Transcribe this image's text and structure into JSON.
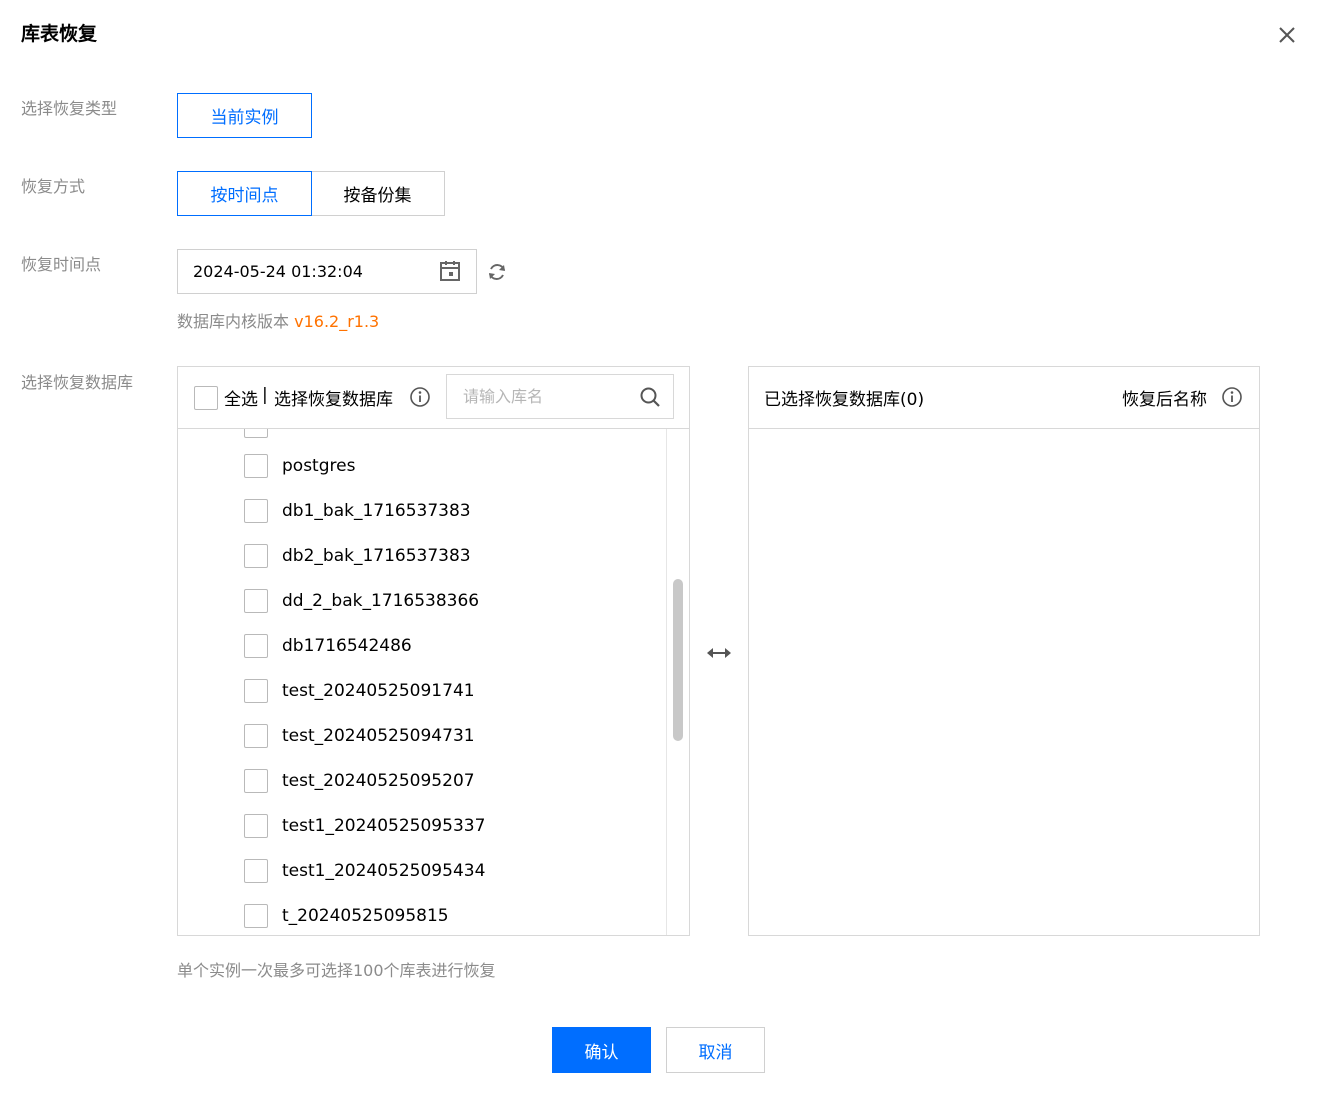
{
  "dialog": {
    "title": "库表恢复"
  },
  "restore_type": {
    "label": "选择恢复类型",
    "option": "当前实例"
  },
  "restore_method": {
    "label": "恢复方式",
    "options": [
      "按时间点",
      "按备份集"
    ],
    "selected": "按时间点"
  },
  "restore_time": {
    "label": "恢复时间点",
    "value": "2024-05-24 01:32:04",
    "version_prefix": "数据库内核版本",
    "version_value": "v16.2_r1.3"
  },
  "database_select": {
    "label": "选择恢复数据库",
    "select_all": "全选",
    "separator": "|",
    "header_title": "选择恢复数据库",
    "search_placeholder": "请输入库名",
    "items": [
      "postgres",
      "db1_bak_1716537383",
      "db2_bak_1716537383",
      "dd_2_bak_1716538366",
      "db1716542486",
      "test_20240525091741",
      "test_20240525094731",
      "test_20240525095207",
      "test1_20240525095337",
      "test1_20240525095434",
      "t_20240525095815"
    ],
    "selected_title": "已选择恢复数据库(0)",
    "rename_title": "恢复后名称",
    "hint": "单个实例一次最多可选择100个库表进行恢复"
  },
  "actions": {
    "confirm": "确认",
    "cancel": "取消"
  },
  "colors": {
    "accent": "#006eff",
    "version": "#ff7200",
    "label": "#8b8b8b",
    "border": "#d8d8d8"
  }
}
